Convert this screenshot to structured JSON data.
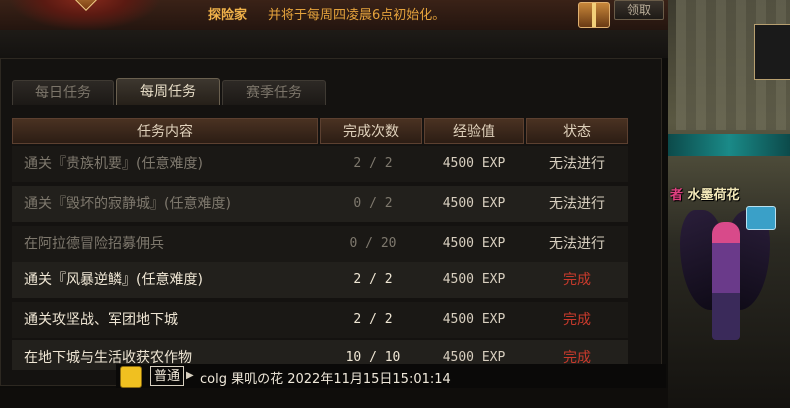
{
  "banner": {
    "tag": "探险家",
    "notice": "并将于每周四凌晨6点初始化。",
    "claim_label": "领取"
  },
  "tabs": [
    {
      "label": "每日任务",
      "active": false
    },
    {
      "label": "每周任务",
      "active": true
    },
    {
      "label": "赛季任务",
      "active": false
    }
  ],
  "table": {
    "columns": [
      "任务内容",
      "完成次数",
      "经验值",
      "状态"
    ],
    "rows": [
      {
        "name": "通关『贵族机要』(任意难度)",
        "count": "2 / 2",
        "exp": "4500 EXP",
        "status": "无法进行",
        "done": false
      },
      {
        "name": "通关『毁坏的寂静城』(任意难度)",
        "count": "0 / 2",
        "exp": "4500 EXP",
        "status": "无法进行",
        "done": false
      },
      {
        "name": "在阿拉德冒险招募佣兵",
        "count": "0 / 20",
        "exp": "4500 EXP",
        "status": "无法进行",
        "done": false
      },
      {
        "name": "通关『风暴逆鳞』(任意难度)",
        "count": "2 / 2",
        "exp": "4500 EXP",
        "status": "完成",
        "done": true
      },
      {
        "name": "通关攻坚战、军团地下城",
        "count": "2 / 2",
        "exp": "4500 EXP",
        "status": "完成",
        "done": true
      },
      {
        "name": "在地下城与生活收获农作物",
        "count": "10 / 10",
        "exp": "4500 EXP",
        "status": "完成",
        "done": true
      }
    ]
  },
  "scene": {
    "character_prefix": "者",
    "character_name": "水墨荷花"
  },
  "chat": {
    "channel": "普通",
    "message": "colg 果叽の花 2022年11月15日15:01:14"
  },
  "colors": {
    "status_done": "#c93a2c",
    "banner_text": "#e4a23c",
    "header_bg": "#3a2719"
  }
}
